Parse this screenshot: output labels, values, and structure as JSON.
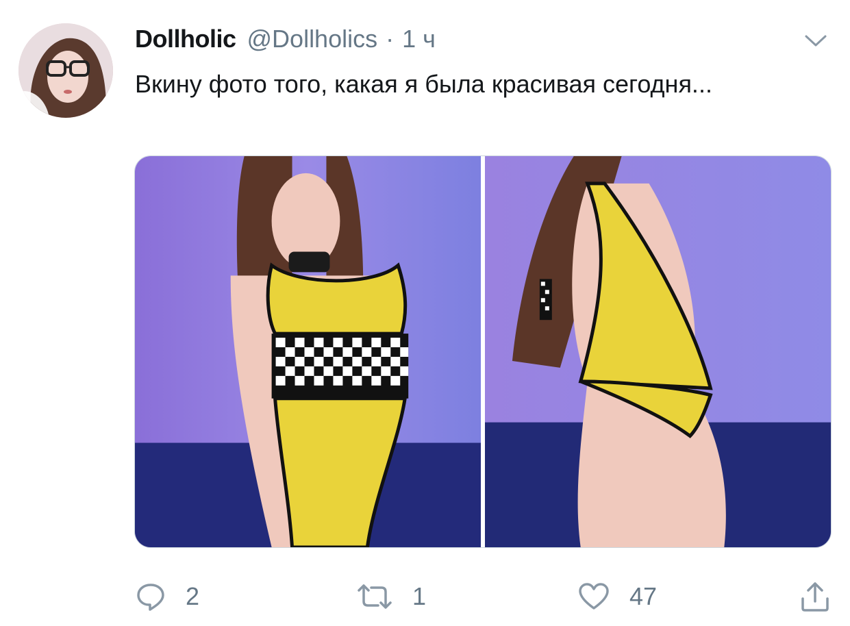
{
  "tweet": {
    "display_name": "Dollholic",
    "handle": "@Dollholics",
    "separator": "·",
    "time": "1 ч",
    "text": "Вкину фото того, какая я была красивая сегодня..."
  },
  "media": {
    "photo_count": 2
  },
  "actions": {
    "reply_count": "2",
    "retweet_count": "1",
    "like_count": "47"
  },
  "colors": {
    "text": "#14171a",
    "secondary": "#657786",
    "border": "#ccd6dd",
    "outfit_yellow": "#e9d33a"
  },
  "icons": {
    "menu": "chevron-down-icon",
    "reply": "reply-icon",
    "retweet": "retweet-icon",
    "like": "heart-icon",
    "share": "share-icon"
  }
}
